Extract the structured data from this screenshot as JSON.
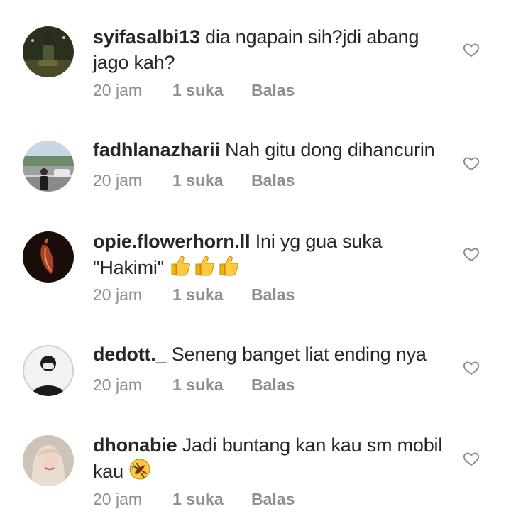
{
  "comments": [
    {
      "username": "syifasalbi13",
      "text": "dia ngapain sih?jdi abang jago kah?",
      "time": "20 jam",
      "likes": "1 suka",
      "reply": "Balas"
    },
    {
      "username": "fadhlanazharii",
      "text": "Nah gitu dong dihancurin",
      "time": "20 jam",
      "likes": "1 suka",
      "reply": "Balas"
    },
    {
      "username": "opie.flowerhorn.ll",
      "text": "Ini yg gua suka \"Hakimi\"",
      "emoji": "thumbs-up x3",
      "time": "20 jam",
      "likes": "1 suka",
      "reply": "Balas"
    },
    {
      "username": "dedott._",
      "text": "Seneng banget liat ending nya",
      "time": "20 jam",
      "likes": "1 suka",
      "reply": "Balas"
    },
    {
      "username": "dhonabie",
      "text": "Jadi buntang kan kau sm mobil kau",
      "emoji": "rolling-on-floor-laughing",
      "time": "20 jam",
      "likes": "1 suka",
      "reply": "Balas"
    }
  ],
  "icons": {
    "like": "heart-outline-icon"
  },
  "colors": {
    "text": "#262626",
    "muted": "#8e8e8e",
    "background": "#ffffff"
  }
}
